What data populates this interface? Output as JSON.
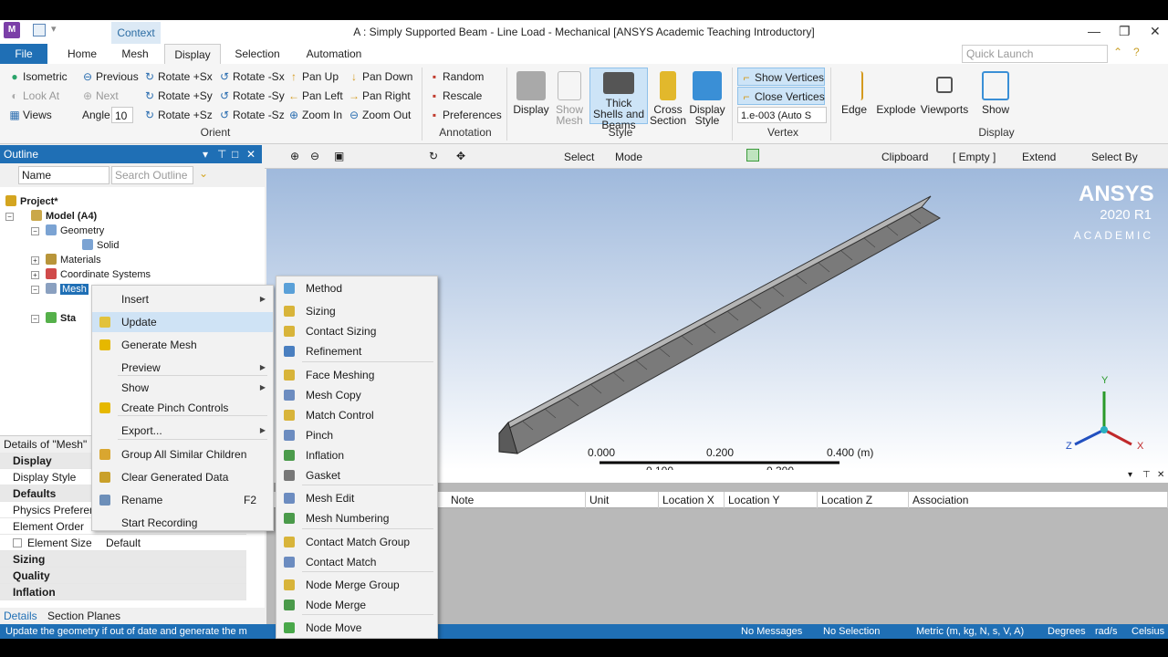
{
  "window": {
    "title": "A : Simply Supported Beam - Line Load - Mechanical [ANSYS Academic Teaching Introductory]",
    "context_tab": "Context",
    "min": "—",
    "max": "❐",
    "close": "✕"
  },
  "tabs": {
    "file": "File",
    "home": "Home",
    "mesh": "Mesh",
    "display": "Display",
    "selection": "Selection",
    "automation": "Automation"
  },
  "quick_launch": {
    "placeholder": "Quick Launch"
  },
  "ribbon": {
    "orient": {
      "isometric": "Isometric",
      "previous": "Previous",
      "next": "Next",
      "look_at": "Look At",
      "views": "Views",
      "angle_label": "Angle",
      "angle_value": "10",
      "rot_px": "Rotate +Sx",
      "rot_py": "Rotate +Sy",
      "rot_pz": "Rotate +Sz",
      "rot_nx": "Rotate -Sx",
      "rot_ny": "Rotate -Sy",
      "rot_nz": "Rotate -Sz",
      "pan_up": "Pan Up",
      "pan_left": "Pan Left",
      "zoom_in": "Zoom In",
      "pan_down": "Pan Down",
      "pan_right": "Pan Right",
      "zoom_out": "Zoom Out",
      "group": "Orient"
    },
    "annotation": {
      "random": "Random",
      "rescale": "Rescale",
      "preferences": "Preferences",
      "group": "Annotation"
    },
    "style": {
      "display": "Display",
      "show_mesh": "Show Mesh",
      "thick": "Thick Shells and Beams",
      "cross": "Cross Section",
      "dstyle": "Display Style",
      "group": "Style"
    },
    "vertex": {
      "show": "Show Vertices",
      "close": "Close Vertices",
      "tol": "1.e-003 (Auto S",
      "group": "Vertex"
    },
    "display": {
      "edge": "Edge",
      "explode": "Explode",
      "viewports": "Viewports",
      "show": "Show",
      "group": "Display"
    }
  },
  "outline": {
    "title": "Outline",
    "name_col": "Name",
    "search_placeholder": "Search Outline"
  },
  "tree": {
    "project": "Project*",
    "model": "Model (A4)",
    "geometry": "Geometry",
    "solid": "Solid",
    "materials": "Materials",
    "coord": "Coordinate Systems",
    "mesh": "Mesh",
    "static": "Sta"
  },
  "details": {
    "title": "Details of \"Mesh\"",
    "display": "Display",
    "display_style": "Display Style",
    "defaults": "Defaults",
    "physics": "Physics Preferen",
    "element_order": "Element Order",
    "element_size": "Element Size",
    "element_size_value": "Default",
    "sizing": "Sizing",
    "quality": "Quality",
    "inflation": "Inflation",
    "tab_details": "Details",
    "tab_section": "Section Planes"
  },
  "gfx_toolbar": {
    "select": "Select",
    "mode": "Mode",
    "clipboard": "Clipboard",
    "empty": "[ Empty ]",
    "extend": "Extend",
    "select_by": "Select By"
  },
  "brand": {
    "name": "ANSYS",
    "version": "2020 R1",
    "edition": "ACADEMIC"
  },
  "scale": {
    "t0": "0.000",
    "t1": "0.200",
    "t2": "0.400 (m)",
    "b1": "0.100",
    "b2": "0.300"
  },
  "axes": {
    "x": "X",
    "y": "Y",
    "z": "Z"
  },
  "table": {
    "cols": [
      "Note",
      "Unit",
      "Location X",
      "Location Y",
      "Location Z",
      "Association"
    ]
  },
  "status": {
    "hint": "Update the geometry if out of date and generate the m",
    "messages": "No Messages",
    "selection": "No Selection",
    "units": "Metric (m, kg, N, s, V, A)",
    "degrees": "Degrees",
    "rads": "rad/s",
    "celsius": "Celsius"
  },
  "menu1": [
    {
      "label": "Insert",
      "sub": true
    },
    {
      "label": "Update",
      "icon": "#e2c23c",
      "hover": true
    },
    {
      "label": "Generate Mesh",
      "icon": "#e6b800"
    },
    {
      "label": "Preview",
      "sub": true
    },
    {
      "label": "Show",
      "sub": true
    },
    {
      "label": "Create Pinch Controls",
      "icon": "#e6b800"
    },
    {
      "label": "Export...",
      "sub": true
    },
    {
      "label": "Group All Similar Children",
      "icon": "#d9a630"
    },
    {
      "label": "Clear Generated Data",
      "icon": "#c9a02a"
    },
    {
      "label": "Rename",
      "shortcut": "F2",
      "icon": "#6d8fb9"
    },
    {
      "label": "Start Recording"
    }
  ],
  "menu2": [
    {
      "label": "Method",
      "icon": "#5aa0d8"
    },
    {
      "label": "Sizing",
      "icon": "#d8b43a"
    },
    {
      "label": "Contact Sizing",
      "icon": "#d8b43a"
    },
    {
      "label": "Refinement",
      "icon": "#4a7fc0"
    },
    {
      "label": "Face Meshing",
      "icon": "#d8b43a"
    },
    {
      "label": "Mesh Copy",
      "icon": "#6c8cc0"
    },
    {
      "label": "Match Control",
      "icon": "#d8b43a"
    },
    {
      "label": "Pinch",
      "icon": "#6c8cc0"
    },
    {
      "label": "Inflation",
      "icon": "#4b9b4b"
    },
    {
      "label": "Gasket",
      "icon": "#777777"
    },
    {
      "label": "Mesh Edit",
      "icon": "#6c8cc0"
    },
    {
      "label": "Mesh Numbering",
      "icon": "#4a9a4a"
    },
    {
      "label": "Contact Match Group",
      "icon": "#d8b43a"
    },
    {
      "label": "Contact Match",
      "icon": "#6c8cc0"
    },
    {
      "label": "Node Merge Group",
      "icon": "#d8b43a"
    },
    {
      "label": "Node Merge",
      "icon": "#4a9a4a"
    },
    {
      "label": "Node Move",
      "icon": "#49a84a"
    }
  ]
}
